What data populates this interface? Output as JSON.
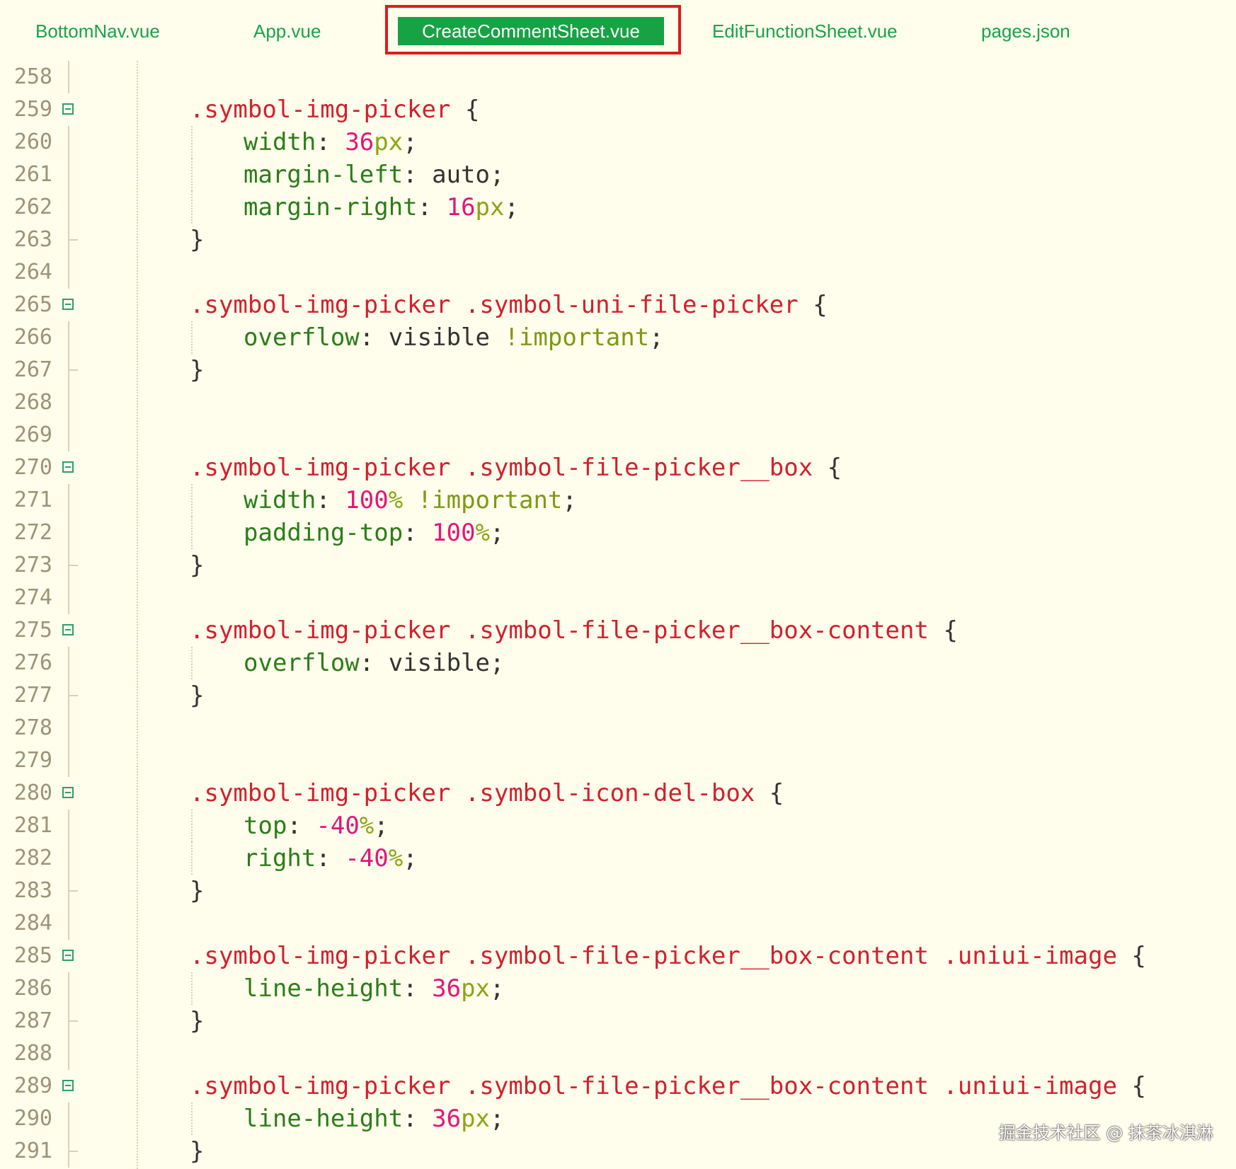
{
  "tabs": [
    {
      "label": "BottomNav.vue",
      "active": false
    },
    {
      "label": "App.vue",
      "active": false
    },
    {
      "label": "CreateCommentSheet.vue",
      "active": true
    },
    {
      "label": "EditFunctionSheet.vue",
      "active": false
    },
    {
      "label": "pages.json",
      "active": false
    }
  ],
  "colors": {
    "background": "#fffdec",
    "selector": "#d1202e",
    "property": "#2b7d18",
    "number": "#e0177a",
    "unit": "#8aa613",
    "active_tab": "#17a244",
    "highlight_frame": "#e01b1b"
  },
  "code_lines": [
    {
      "n": "258",
      "fold": false,
      "end": false,
      "tokens": []
    },
    {
      "n": "259",
      "fold": true,
      "end": false,
      "tokens": [
        [
          "sel",
          ".symbol-img-picker"
        ],
        [
          "plain",
          " {"
        ]
      ]
    },
    {
      "n": "260",
      "fold": false,
      "end": false,
      "indent": true,
      "tokens": [
        [
          "prop",
          "width"
        ],
        [
          "plain",
          ": "
        ],
        [
          "num",
          "36"
        ],
        [
          "unit",
          "px"
        ],
        [
          "plain",
          ";"
        ]
      ]
    },
    {
      "n": "261",
      "fold": false,
      "end": false,
      "indent": true,
      "tokens": [
        [
          "prop",
          "margin-left"
        ],
        [
          "plain",
          ": auto;"
        ]
      ]
    },
    {
      "n": "262",
      "fold": false,
      "end": false,
      "indent": true,
      "tokens": [
        [
          "prop",
          "margin-right"
        ],
        [
          "plain",
          ": "
        ],
        [
          "num",
          "16"
        ],
        [
          "unit",
          "px"
        ],
        [
          "plain",
          ";"
        ]
      ]
    },
    {
      "n": "263",
      "fold": false,
      "end": true,
      "tokens": [
        [
          "plain",
          "}"
        ]
      ]
    },
    {
      "n": "264",
      "fold": false,
      "end": false,
      "tokens": []
    },
    {
      "n": "265",
      "fold": true,
      "end": false,
      "tokens": [
        [
          "sel",
          ".symbol-img-picker .symbol-uni-file-picker"
        ],
        [
          "plain",
          " {"
        ]
      ]
    },
    {
      "n": "266",
      "fold": false,
      "end": false,
      "indent": true,
      "tokens": [
        [
          "prop",
          "overflow"
        ],
        [
          "plain",
          ": visible "
        ],
        [
          "kw",
          "!important"
        ],
        [
          "plain",
          ";"
        ]
      ]
    },
    {
      "n": "267",
      "fold": false,
      "end": true,
      "tokens": [
        [
          "plain",
          "}"
        ]
      ]
    },
    {
      "n": "268",
      "fold": false,
      "end": false,
      "tokens": []
    },
    {
      "n": "269",
      "fold": false,
      "end": false,
      "tokens": []
    },
    {
      "n": "270",
      "fold": true,
      "end": false,
      "tokens": [
        [
          "sel",
          ".symbol-img-picker .symbol-file-picker__box"
        ],
        [
          "plain",
          " {"
        ]
      ]
    },
    {
      "n": "271",
      "fold": false,
      "end": false,
      "indent": true,
      "tokens": [
        [
          "prop",
          "width"
        ],
        [
          "plain",
          ": "
        ],
        [
          "num",
          "100"
        ],
        [
          "unit",
          "%"
        ],
        [
          "plain",
          " "
        ],
        [
          "kw",
          "!important"
        ],
        [
          "plain",
          ";"
        ]
      ]
    },
    {
      "n": "272",
      "fold": false,
      "end": false,
      "indent": true,
      "tokens": [
        [
          "prop",
          "padding-top"
        ],
        [
          "plain",
          ": "
        ],
        [
          "num",
          "100"
        ],
        [
          "unit",
          "%"
        ],
        [
          "plain",
          ";"
        ]
      ]
    },
    {
      "n": "273",
      "fold": false,
      "end": true,
      "tokens": [
        [
          "plain",
          "}"
        ]
      ]
    },
    {
      "n": "274",
      "fold": false,
      "end": false,
      "tokens": []
    },
    {
      "n": "275",
      "fold": true,
      "end": false,
      "tokens": [
        [
          "sel",
          ".symbol-img-picker .symbol-file-picker__box-content"
        ],
        [
          "plain",
          " {"
        ]
      ]
    },
    {
      "n": "276",
      "fold": false,
      "end": false,
      "indent": true,
      "tokens": [
        [
          "prop",
          "overflow"
        ],
        [
          "plain",
          ": visible;"
        ]
      ]
    },
    {
      "n": "277",
      "fold": false,
      "end": true,
      "tokens": [
        [
          "plain",
          "}"
        ]
      ]
    },
    {
      "n": "278",
      "fold": false,
      "end": false,
      "tokens": []
    },
    {
      "n": "279",
      "fold": false,
      "end": false,
      "tokens": []
    },
    {
      "n": "280",
      "fold": true,
      "end": false,
      "tokens": [
        [
          "sel",
          ".symbol-img-picker .symbol-icon-del-box"
        ],
        [
          "plain",
          " {"
        ]
      ]
    },
    {
      "n": "281",
      "fold": false,
      "end": false,
      "indent": true,
      "tokens": [
        [
          "prop",
          "top"
        ],
        [
          "plain",
          ": "
        ],
        [
          "num",
          "-40"
        ],
        [
          "unit",
          "%"
        ],
        [
          "plain",
          ";"
        ]
      ]
    },
    {
      "n": "282",
      "fold": false,
      "end": false,
      "indent": true,
      "tokens": [
        [
          "prop",
          "right"
        ],
        [
          "plain",
          ": "
        ],
        [
          "num",
          "-40"
        ],
        [
          "unit",
          "%"
        ],
        [
          "plain",
          ";"
        ]
      ]
    },
    {
      "n": "283",
      "fold": false,
      "end": true,
      "tokens": [
        [
          "plain",
          "}"
        ]
      ]
    },
    {
      "n": "284",
      "fold": false,
      "end": false,
      "tokens": []
    },
    {
      "n": "285",
      "fold": true,
      "end": false,
      "tokens": [
        [
          "sel",
          ".symbol-img-picker .symbol-file-picker__box-content .uniui-image"
        ],
        [
          "plain",
          " {"
        ]
      ]
    },
    {
      "n": "286",
      "fold": false,
      "end": false,
      "indent": true,
      "tokens": [
        [
          "prop",
          "line-height"
        ],
        [
          "plain",
          ": "
        ],
        [
          "num",
          "36"
        ],
        [
          "unit",
          "px"
        ],
        [
          "plain",
          ";"
        ]
      ]
    },
    {
      "n": "287",
      "fold": false,
      "end": true,
      "tokens": [
        [
          "plain",
          "}"
        ]
      ]
    },
    {
      "n": "288",
      "fold": false,
      "end": false,
      "tokens": []
    },
    {
      "n": "289",
      "fold": true,
      "end": false,
      "tokens": [
        [
          "sel",
          ".symbol-img-picker .symbol-file-picker__box-content .uniui-image"
        ],
        [
          "plain",
          " {"
        ]
      ]
    },
    {
      "n": "290",
      "fold": false,
      "end": false,
      "indent": true,
      "tokens": [
        [
          "prop",
          "line-height"
        ],
        [
          "plain",
          ": "
        ],
        [
          "num",
          "36"
        ],
        [
          "unit",
          "px"
        ],
        [
          "plain",
          ";"
        ]
      ]
    },
    {
      "n": "291",
      "fold": false,
      "end": true,
      "tokens": [
        [
          "plain",
          "}"
        ]
      ]
    }
  ],
  "watermark": "掘金技术社区 @ 抹茶冰淇淋"
}
